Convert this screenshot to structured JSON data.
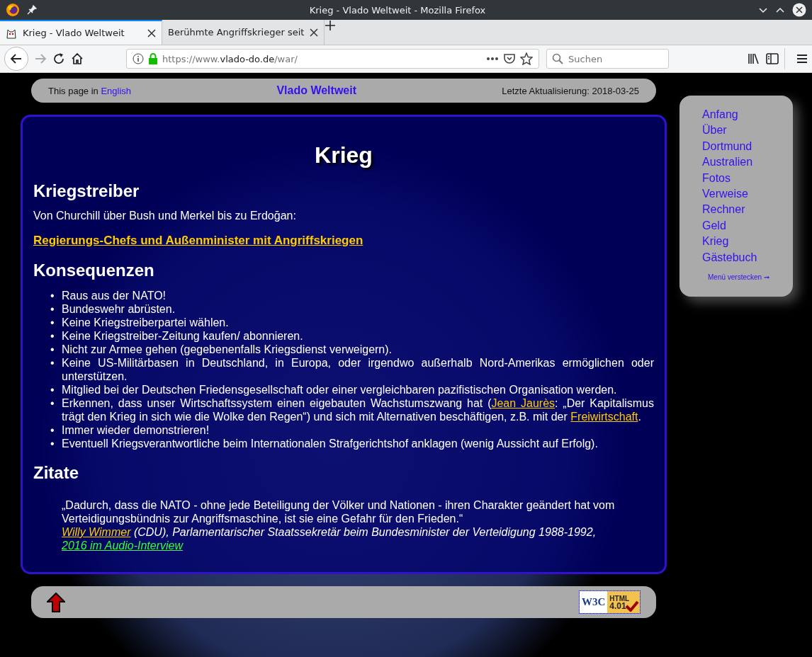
{
  "window": {
    "title": "Krieg - Vlado Weltweit - Mozilla Firefox",
    "tabs": [
      {
        "label": "Krieg - Vlado Weltweit",
        "selected": true
      },
      {
        "label": "Berühmte Angriffskrieger seit",
        "selected": false
      }
    ],
    "url": {
      "scheme": "https://www.",
      "domain": "vlado-do.de",
      "path": "/war/"
    },
    "search": {
      "placeholder": "Suchen"
    }
  },
  "header": {
    "language_prefix": "This page in",
    "language_link": "English",
    "site_title": "Vlado Weltweit",
    "updated": "Letzte Aktualisierung: 2018-03-25"
  },
  "article": {
    "title": "Krieg",
    "sections": [
      {
        "heading": "Kriegstreiber",
        "blocks": [
          {
            "kind": "paragraph",
            "text": "Von Churchill über Bush und Merkel bis zu Erdoğan:"
          },
          {
            "kind": "bold_link",
            "text": "Regierungs-Chefs und Außenminister mit Angriffskriegen"
          }
        ]
      },
      {
        "heading": "Konsequenzen",
        "blocks": [
          {
            "kind": "list",
            "marker": "•",
            "items": [
              [
                {
                  "text": "Raus aus der NATO!"
                }
              ],
              [
                {
                  "text": "Bundeswehr abrüsten."
                }
              ],
              [
                {
                  "text": "Keine Kriegstreiberpartei wählen."
                }
              ],
              [
                {
                  "text": "Keine Kriegstreiber-Zeitung kaufen/ abonnieren."
                }
              ],
              [
                {
                  "text": "Nicht zur Armee gehen (gegebenenfalls Kriegsdienst verweigern)."
                }
              ],
              [
                {
                  "text": "Keine US-Militärbasen in Deutschland, in Europa, oder irgendwo außerhalb Nord-Amerikas ermöglichen oder unterstützen."
                }
              ],
              [
                {
                  "text": "Mitglied bei der Deutschen Friedensgesellschaft oder einer vergleichbaren pazifistischen Organisation werden."
                }
              ],
              [
                {
                  "text": "Erkennen, dass unser Wirtschaftssystem einen eigebauten Wachstumszwang hat ("
                },
                {
                  "link": "Jean Jaurès",
                  "color": "#ffcc00"
                },
                {
                  "text": ": „Der Kapitalismus trägt den Krieg in sich wie die Wolke den Regen“) und sich mit Alternativen beschäftigen, z.B. mit der "
                },
                {
                  "link": "Freiwirtschaft",
                  "color": "#ffcc00"
                },
                {
                  "text": "."
                }
              ],
              [
                {
                  "text": "Immer wieder demonstrieren!"
                }
              ],
              [
                {
                  "text": "Eventuell Kriegsverantwortliche beim Internationalen Strafgerichtshof anklagen (wenig Aussicht auf Erfolg)."
                }
              ]
            ]
          }
        ]
      },
      {
        "heading": "Zitate",
        "blocks": [
          {
            "kind": "quote",
            "text": "„Dadurch, dass die NATO - ohne jede Beteiligung der Völker und Nationen - ihren Charakter geändert hat vom Verteidigungsbündnis zur Angriffsmaschine, ist sie eine Gefahr für den Frieden.“",
            "attribution": [
              {
                "link": "Willy Wimmer",
                "color": "#ffcc00"
              },
              {
                "text": " (CDU), Parlamentarischer Staatssekretär beim Bundesminister der Verteidigung 1988-1992, "
              },
              {
                "link": "2016 im Audio-Interview",
                "color": "#33ff33"
              }
            ]
          }
        ]
      }
    ]
  },
  "menu": {
    "items": [
      "Anfang",
      "Über",
      "Dortmund",
      "Australien",
      "Fotos",
      "Verweise",
      "Rechner",
      "Geld",
      "Krieg",
      "Gästebuch"
    ],
    "hide_link": "Menü verstecken ➞"
  },
  "footer": {
    "badge": {
      "org": "W3C",
      "label": "HTML",
      "version": "4.01"
    }
  }
}
